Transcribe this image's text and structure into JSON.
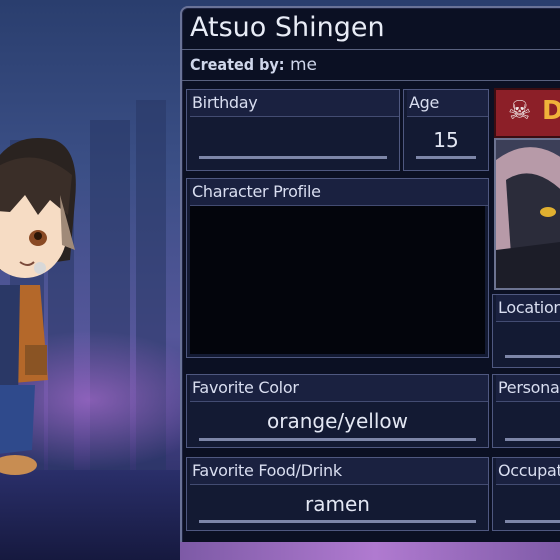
{
  "character": {
    "name": "Atsuo Shingen",
    "created_by_label": "Created by:",
    "created_by_value": "me"
  },
  "fields": {
    "birthday": {
      "label": "Birthday",
      "value": ""
    },
    "age": {
      "label": "Age",
      "value": "15"
    },
    "profile": {
      "label": "Character Profile",
      "value": ""
    },
    "location": {
      "label": "Location",
      "value": ""
    },
    "favorite_color": {
      "label": "Favorite Color",
      "value": "orange/yellow"
    },
    "personality": {
      "label": "Persona",
      "value": ""
    },
    "favorite_food": {
      "label": "Favorite Food/Drink",
      "value": "ramen"
    },
    "occupation": {
      "label": "Occupat",
      "value": ""
    }
  },
  "badge": {
    "icon": "skull-icon",
    "glyph": "☠",
    "letter": "D"
  },
  "colors": {
    "panel_bg": "#0b1023",
    "box_bg": "#131a33",
    "border": "#4f5880",
    "accent_badge": "#8c1f28"
  }
}
